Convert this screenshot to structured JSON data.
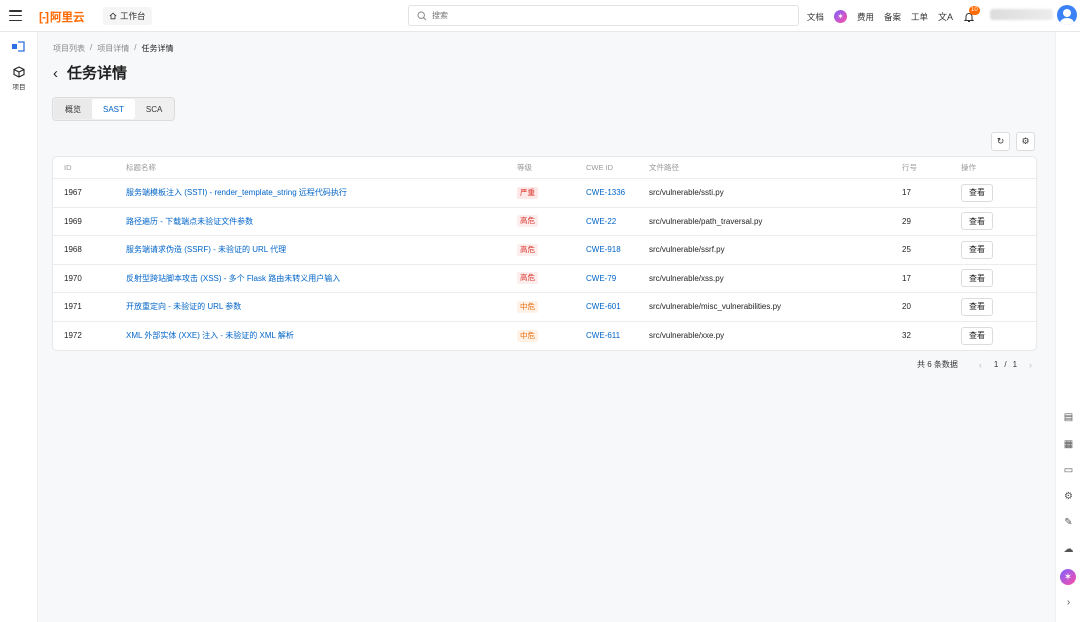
{
  "topbar": {
    "logo_text": "阿里云",
    "workbench_label": "工作台",
    "search_placeholder": "搜索",
    "links": [
      "文档",
      "费用",
      "备案",
      "工单"
    ],
    "notification_count": "10"
  },
  "sidebar": {
    "item_label": "项目"
  },
  "breadcrumb": [
    "项目列表",
    "项目详情",
    "任务详情"
  ],
  "page": {
    "title": "任务详情"
  },
  "tabs": [
    {
      "label": "概览",
      "active": false
    },
    {
      "label": "SAST",
      "active": true
    },
    {
      "label": "SCA",
      "active": false
    }
  ],
  "table": {
    "headers": [
      "ID",
      "标题名称",
      "等级",
      "CWE ID",
      "文件路径",
      "行号",
      "操作"
    ],
    "rows": [
      {
        "id": "1967",
        "name": "服务端模板注入 (SSTI) - render_template_string 远程代码执行",
        "level": "严重",
        "cwe": "CWE-1336",
        "path": "src/vulnerable/ssti.py",
        "line": "17",
        "op": "查看"
      },
      {
        "id": "1969",
        "name": "路径遍历 - 下载端点未验证文件参数",
        "level": "高危",
        "cwe": "CWE-22",
        "path": "src/vulnerable/path_traversal.py",
        "line": "29",
        "op": "查看"
      },
      {
        "id": "1968",
        "name": "服务端请求伪造 (SSRF) - 未验证的 URL 代理",
        "level": "高危",
        "cwe": "CWE-918",
        "path": "src/vulnerable/ssrf.py",
        "line": "25",
        "op": "查看"
      },
      {
        "id": "1970",
        "name": "反射型跨站脚本攻击 (XSS) - 多个 Flask 路由未转义用户输入",
        "level": "高危",
        "cwe": "CWE-79",
        "path": "src/vulnerable/xss.py",
        "line": "17",
        "op": "查看"
      },
      {
        "id": "1971",
        "name": "开放重定向 - 未验证的 URL 参数",
        "level": "中危",
        "cwe": "CWE-601",
        "path": "src/vulnerable/misc_vulnerabilities.py",
        "line": "20",
        "op": "查看"
      },
      {
        "id": "1972",
        "name": "XML 外部实体 (XXE) 注入 - 未验证的 XML 解析",
        "level": "中危",
        "cwe": "CWE-611",
        "path": "src/vulnerable/xxe.py",
        "line": "32",
        "op": "查看"
      }
    ]
  },
  "pagination": {
    "total_text": "共 6 条数据",
    "current": "1",
    "separator": "/",
    "pages": "1"
  },
  "colors": {
    "brand": "#ff6a00",
    "link": "#0064c8",
    "critical": "#d93026",
    "medium": "#e36c0a"
  }
}
